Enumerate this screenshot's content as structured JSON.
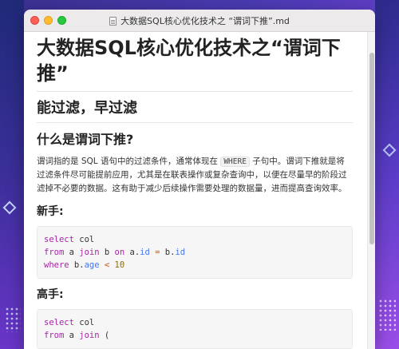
{
  "window": {
    "title": "大数据SQL核心优化技术之 “谓词下推”.md"
  },
  "doc": {
    "title": "大数据SQL核心优化技术之“谓词下推”",
    "section": "能过滤，早过滤",
    "subsection": "什么是谓词下推?",
    "para_before_code": "谓词指的是 SQL 语句中的过滤条件，通常体现在",
    "inline_code": "WHERE",
    "para_after_code": "子句中。谓词下推就是将过滤条件尽可能提前应用，尤其是在联表操作或复杂查询中，以便在尽量早的阶段过滤掉不必要的数据。这有助于减少后续操作需要处理的数据量，进而提高查询效率。",
    "novice_heading": "新手:",
    "novice_code": {
      "line1_kw": "select",
      "line1_rest": " col",
      "line2_from": "from",
      "line2_a": " a ",
      "line2_join": "join",
      "line2_b": " b ",
      "line2_on": "on",
      "line2_aid": " a.",
      "line2_id1": "id",
      "line2_eq": " = ",
      "line2_bid": "b.",
      "line2_id2": "id",
      "line3_where": "where",
      "line3_b": " b.",
      "line3_age": "age",
      "line3_lt": " < ",
      "line3_num": "10"
    },
    "expert_heading": "高手:",
    "expert_code": {
      "line1_kw": "select",
      "line1_rest": " col",
      "line2_from": "from",
      "line2_a": " a ",
      "line2_join": "join",
      "line2_paren": " ("
    }
  },
  "colors": {
    "keyword": "#a626a4",
    "field": "#4078f2",
    "number": "#986801",
    "operator": "#c05a17"
  }
}
